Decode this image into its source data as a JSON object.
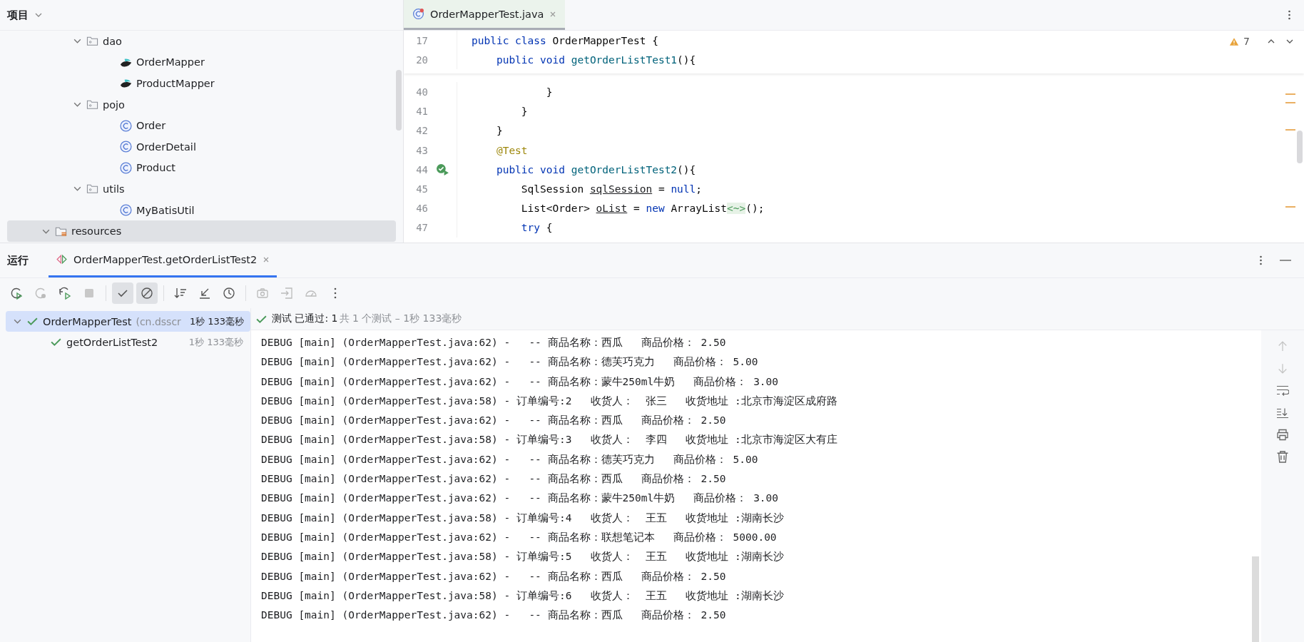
{
  "project_panel": {
    "title": "项目",
    "inner_folders": [
      {
        "label": "dao",
        "kind": "package",
        "expanded": true,
        "selected": false,
        "children": [
          {
            "label": "OrderMapper",
            "kind": "mapper",
            "selected": false
          },
          {
            "label": "ProductMapper",
            "kind": "mapper",
            "selected": false
          }
        ]
      },
      {
        "label": "pojo",
        "kind": "package",
        "expanded": true,
        "selected": false,
        "children": [
          {
            "label": "Order",
            "kind": "class",
            "selected": false
          },
          {
            "label": "OrderDetail",
            "kind": "class",
            "selected": false
          },
          {
            "label": "Product",
            "kind": "class",
            "selected": false
          }
        ]
      },
      {
        "label": "utils",
        "kind": "package",
        "expanded": true,
        "selected": false,
        "children": [
          {
            "label": "MyBatisUtil",
            "kind": "class",
            "selected": false
          }
        ]
      }
    ],
    "outer_folders": [
      {
        "label": "resources",
        "kind": "resources",
        "expanded": true,
        "selected": true
      }
    ]
  },
  "editor": {
    "tab": {
      "label": "OrderMapperTest.java",
      "selected": true
    },
    "warnings": "7",
    "sticky_lines": [
      {
        "number": "17",
        "run_icon": false,
        "tokens": [
          {
            "t": "public class ",
            "kind": "kw"
          },
          {
            "t": "OrderMapperTest {",
            "kind": "plain"
          }
        ]
      },
      {
        "number": "20",
        "run_icon": false,
        "tokens": [
          {
            "t": "    public void ",
            "kind": "kw"
          },
          {
            "t": "getOrderListTest1",
            "kind": "fn"
          },
          {
            "t": "(){",
            "kind": "plain"
          }
        ]
      }
    ],
    "lines": [
      {
        "number": "40",
        "run_icon": false,
        "tokens": [
          {
            "t": "            }",
            "kind": "plain"
          }
        ]
      },
      {
        "number": "41",
        "run_icon": false,
        "tokens": [
          {
            "t": "        }",
            "kind": "plain"
          }
        ]
      },
      {
        "number": "42",
        "run_icon": false,
        "tokens": [
          {
            "t": "    }",
            "kind": "plain"
          }
        ]
      },
      {
        "number": "43",
        "run_icon": false,
        "tokens": [
          {
            "t": "    @Test",
            "kind": "ann"
          }
        ]
      },
      {
        "number": "44",
        "run_icon": true,
        "tokens": [
          {
            "t": "    public void ",
            "kind": "kw"
          },
          {
            "t": "getOrderListTest2",
            "kind": "fn"
          },
          {
            "t": "(){",
            "kind": "plain"
          }
        ]
      },
      {
        "number": "45",
        "run_icon": false,
        "tokens": [
          {
            "t": "        SqlSession ",
            "kind": "plain"
          },
          {
            "t": "sqlSession",
            "kind": "var"
          },
          {
            "t": " = ",
            "kind": "plain"
          },
          {
            "t": "null",
            "kind": "kw"
          },
          {
            "t": ";",
            "kind": "plain"
          }
        ]
      },
      {
        "number": "46",
        "run_icon": false,
        "tokens": [
          {
            "t": "        List<Order> ",
            "kind": "plain"
          },
          {
            "t": "oList",
            "kind": "var"
          },
          {
            "t": " = ",
            "kind": "plain"
          },
          {
            "t": "new ",
            "kind": "kw"
          },
          {
            "t": "ArrayList",
            "kind": "plain"
          },
          {
            "t": "<~>",
            "kind": "fold"
          },
          {
            "t": "();",
            "kind": "plain"
          }
        ]
      },
      {
        "number": "47",
        "run_icon": false,
        "tokens": [
          {
            "t": "        try ",
            "kind": "kw"
          },
          {
            "t": "{",
            "kind": "plain"
          }
        ]
      }
    ]
  },
  "run_panel": {
    "title": "运行",
    "tab": {
      "label": "OrderMapperTest.getOrderListTest2",
      "selected": true
    },
    "toggles": [
      {
        "kind": "show-passed",
        "on": true
      },
      {
        "kind": "show-ignored",
        "on": true
      }
    ],
    "tests": [
      {
        "name": "OrderMapperTest",
        "detail": "(cn.dsscr",
        "time": "1秒 133毫秒",
        "passed": true,
        "selected": true,
        "expanded": true,
        "children": [
          {
            "name": "getOrderListTest2",
            "time": "1秒 133毫秒",
            "passed": true,
            "selected": false
          }
        ]
      }
    ],
    "status": {
      "result": "测试 已通过: 1",
      "summary": "共 1 个测试 – 1秒 133毫秒"
    },
    "console": [
      "DEBUG [main] (OrderMapperTest.java:62) -   -- 商品名称：西瓜   商品价格： 2.50",
      "DEBUG [main] (OrderMapperTest.java:62) -   -- 商品名称：德芙巧克力   商品价格： 5.00",
      "DEBUG [main] (OrderMapperTest.java:62) -   -- 商品名称：蒙牛250ml牛奶   商品价格： 3.00",
      "DEBUG [main] (OrderMapperTest.java:58) - 订单编号:2   收货人：  张三   收货地址 :北京市海淀区成府路",
      "DEBUG [main] (OrderMapperTest.java:62) -   -- 商品名称：西瓜   商品价格： 2.50",
      "DEBUG [main] (OrderMapperTest.java:58) - 订单编号:3   收货人：  李四   收货地址 :北京市海淀区大有庄",
      "DEBUG [main] (OrderMapperTest.java:62) -   -- 商品名称：德芙巧克力   商品价格： 5.00",
      "DEBUG [main] (OrderMapperTest.java:62) -   -- 商品名称：西瓜   商品价格： 2.50",
      "DEBUG [main] (OrderMapperTest.java:62) -   -- 商品名称：蒙牛250ml牛奶   商品价格： 3.00",
      "DEBUG [main] (OrderMapperTest.java:58) - 订单编号:4   收货人：  王五   收货地址 :湖南长沙",
      "DEBUG [main] (OrderMapperTest.java:62) -   -- 商品名称：联想笔记本   商品价格： 5000.00",
      "DEBUG [main] (OrderMapperTest.java:58) - 订单编号:5   收货人：  王五   收货地址 :湖南长沙",
      "DEBUG [main] (OrderMapperTest.java:62) -   -- 商品名称：西瓜   商品价格： 2.50",
      "DEBUG [main] (OrderMapperTest.java:58) - 订单编号:6   收货人：  王五   收货地址 :湖南长沙",
      "DEBUG [main] (OrderMapperTest.java:62) -   -- 商品名称：西瓜   商品价格： 2.50"
    ]
  }
}
